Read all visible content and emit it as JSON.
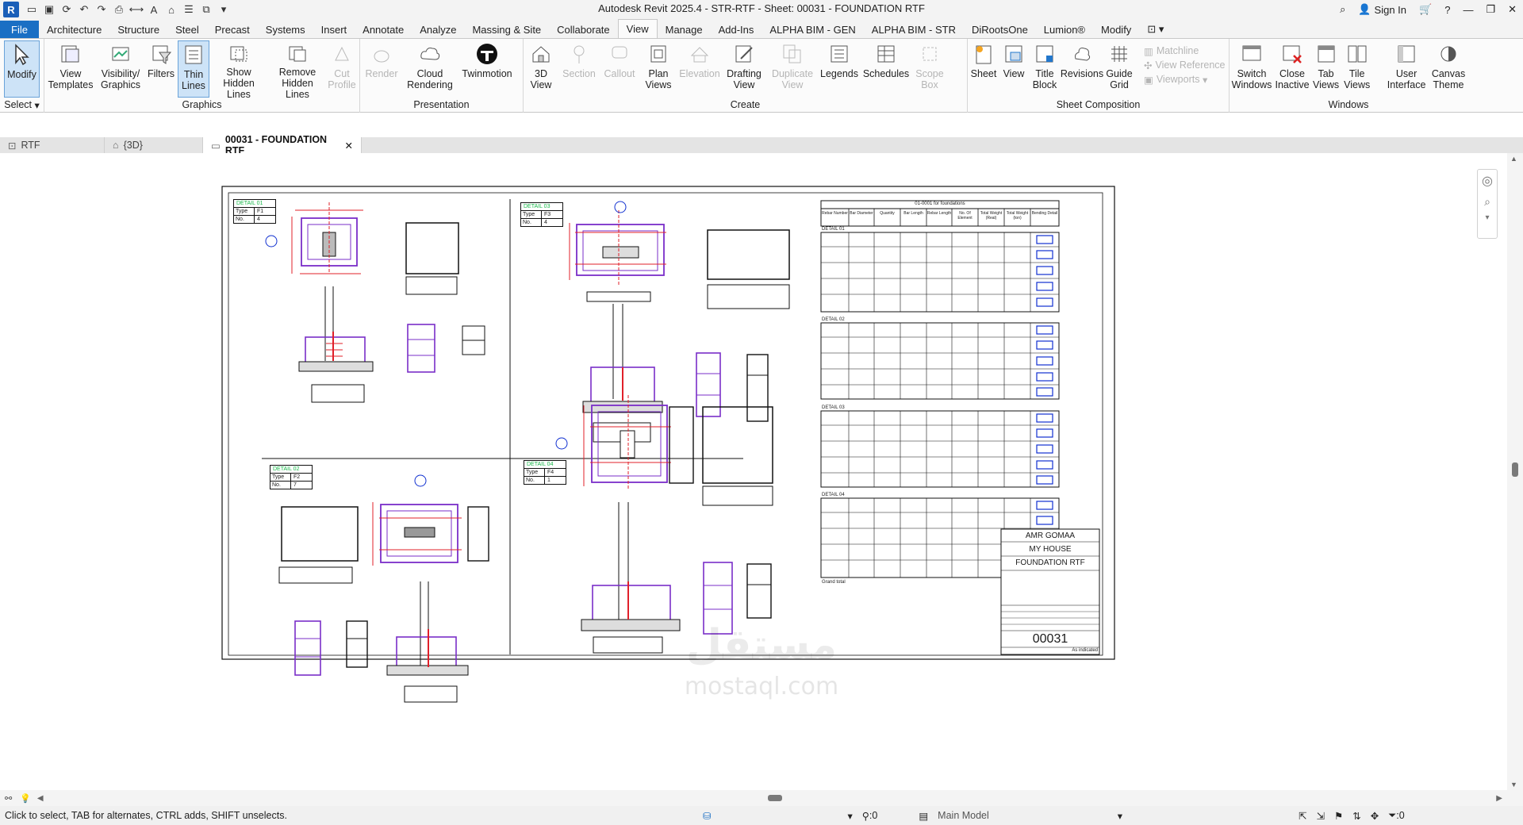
{
  "app": {
    "logo": "R",
    "title": "Autodesk Revit 2025.4 - STR-RTF - Sheet: 00031 - FOUNDATION RTF",
    "sign_in": "Sign In"
  },
  "ribbon_tabs": [
    "File",
    "Architecture",
    "Structure",
    "Steel",
    "Precast",
    "Systems",
    "Insert",
    "Annotate",
    "Analyze",
    "Massing & Site",
    "Collaborate",
    "View",
    "Manage",
    "Add-Ins",
    "ALPHA BIM - GEN",
    "ALPHA BIM - STR",
    "DiRootsOne",
    "Lumion®",
    "Modify"
  ],
  "active_tab": "View",
  "panels": {
    "select": {
      "label": "Select",
      "modify": "Modify"
    },
    "graphics": {
      "label": "Graphics",
      "buttons": [
        "View Templates",
        "Visibility/ Graphics",
        "Filters",
        "Thin Lines",
        "Show Hidden Lines",
        "Remove Hidden Lines",
        "Cut Profile"
      ]
    },
    "presentation": {
      "label": "Presentation",
      "buttons": [
        "Render",
        "Cloud Rendering",
        "Twinmotion"
      ]
    },
    "create": {
      "label": "Create",
      "buttons": [
        "3D View",
        "Section",
        "Callout",
        "Plan Views",
        "Elevation",
        "Drafting View",
        "Duplicate View",
        "Legends",
        "Schedules",
        "Scope Box"
      ]
    },
    "sheet_composition": {
      "label": "Sheet Composition",
      "buttons": [
        "Sheet",
        "View",
        "Title Block",
        "Revisions",
        "Guide Grid"
      ],
      "small": [
        "Matchline",
        "View Reference",
        "Viewports"
      ]
    },
    "windows": {
      "label": "Windows",
      "buttons": [
        "Switch Windows",
        "Close Inactive",
        "Tab Views",
        "Tile Views",
        "User Interface",
        "Canvas Theme"
      ]
    }
  },
  "doc_tabs": [
    "RTF",
    "{3D}",
    "00031 - FOUNDATION RTF"
  ],
  "sheet": {
    "details": [
      {
        "title": "DETAIL 01",
        "type": "F1",
        "no": "4"
      },
      {
        "title": "DETAIL 02",
        "type": "F2",
        "no": "7"
      },
      {
        "title": "DETAIL 03",
        "type": "F3",
        "no": "4"
      },
      {
        "title": "DETAIL 04",
        "type": "F4",
        "no": "1"
      }
    ],
    "type_label": "Type",
    "no_label": "No.",
    "schedule_title": "01-0001 for foundations",
    "schedule_headers": [
      "Rebar Number",
      "Bar Diameter",
      "Quantity",
      "Bar Length",
      "Rebar Length",
      "No. Of Element",
      "Total Weight (Real)",
      "Total Weight (ton)",
      "Bending Detail"
    ],
    "schedule_groups": [
      "DETAIL 01",
      "DETAIL 02",
      "DETAIL 03",
      "DETAIL 04"
    ],
    "grand_total": "Grand total",
    "titleblock": {
      "line1": "AMR GOMAA",
      "line2": "MY HOUSE",
      "line3": "FOUNDATION RTF",
      "number": "00031",
      "scale": "As indicated"
    }
  },
  "watermark": {
    "line1": "مستقل",
    "line2": "mostaql.com"
  },
  "status": {
    "hint": "Click to select, TAB for alternates, CTRL adds, SHIFT unselects.",
    "model": "Main Model",
    "count_left": ":0",
    "count_right": ":0"
  },
  "colors": {
    "accent": "#1a6fc4",
    "red": "#e0202a",
    "purple": "#7a2ec8",
    "blue": "#1030d0",
    "olive": "#8a8a00"
  }
}
